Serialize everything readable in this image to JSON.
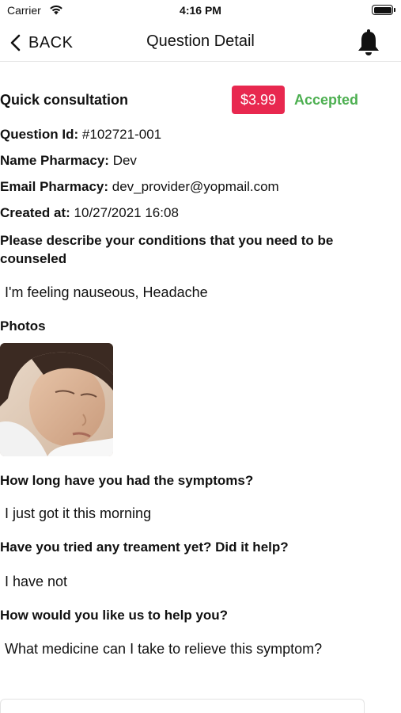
{
  "status_bar": {
    "carrier": "Carrier",
    "time": "4:16 PM"
  },
  "nav": {
    "back_label": "BACK",
    "title": "Question Detail"
  },
  "question": {
    "type": "Quick consultation",
    "price": "$3.99",
    "status": "Accepted",
    "status_color": "#4caf50",
    "price_color": "#e8284f",
    "id_label": "Question Id:",
    "id_value": "#102721-001",
    "pharmacy_label": "Name Pharmacy:",
    "pharmacy_value": "Dev",
    "email_label": "Email Pharmacy:",
    "email_value": "dev_provider@yopmail.com",
    "created_label": "Created at:",
    "created_value": "10/27/2021 16:08"
  },
  "qa": [
    {
      "question": "Please describe your conditions that you need to be counseled",
      "answer": "I'm feeling nauseous, Headache"
    },
    {
      "question": "How long have you had the symptoms?",
      "answer": "I just got it this morning"
    },
    {
      "question": "Have you tried any treament yet? Did it help?",
      "answer": "I have not"
    },
    {
      "question": "How would you like us to help you?",
      "answer": "What medicine can I take to relieve this symptom?"
    }
  ],
  "photos": {
    "label": "Photos",
    "items": [
      "woman-headache-photo"
    ]
  }
}
